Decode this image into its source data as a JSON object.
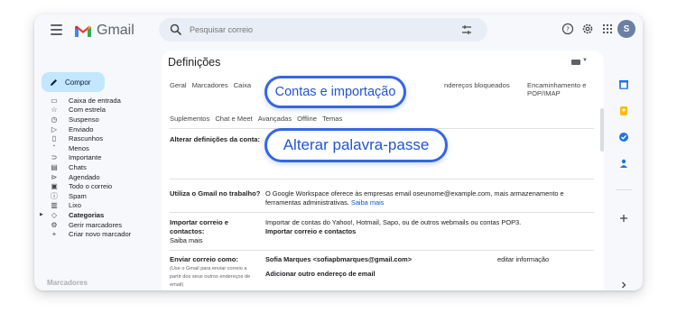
{
  "app": {
    "name": "Gmail"
  },
  "search": {
    "placeholder": "Pesquisar correio"
  },
  "account": {
    "avatar_letter": "S"
  },
  "compose": {
    "label": "Compor"
  },
  "sidebar": {
    "items": [
      {
        "label": "Caixa de entrada",
        "icon": "inbox-icon",
        "glyph": "▭"
      },
      {
        "label": "Com estrela",
        "icon": "star-icon",
        "glyph": "☆"
      },
      {
        "label": "Suspenso",
        "icon": "clock-icon",
        "glyph": "◷"
      },
      {
        "label": "Enviado",
        "icon": "send-icon",
        "glyph": "▷"
      },
      {
        "label": "Rascunhos",
        "icon": "draft-icon",
        "glyph": "▯"
      },
      {
        "label": "Menos",
        "icon": "chevron-up-icon",
        "glyph": "ˆ"
      },
      {
        "label": "Importante",
        "icon": "important-icon",
        "glyph": "⊃"
      },
      {
        "label": "Chats",
        "icon": "chat-icon",
        "glyph": "▤"
      },
      {
        "label": "Agendado",
        "icon": "scheduled-icon",
        "glyph": "⊳"
      },
      {
        "label": "Todo o correio",
        "icon": "all-mail-icon",
        "glyph": "▣"
      },
      {
        "label": "Spam",
        "icon": "spam-icon",
        "glyph": "ⓘ"
      },
      {
        "label": "Lixo",
        "icon": "trash-icon",
        "glyph": "▥"
      },
      {
        "label": "Categorias",
        "icon": "label-icon",
        "glyph": "◇",
        "bold": true
      },
      {
        "label": "Gerir marcadores",
        "icon": "gear-icon",
        "glyph": "⚙"
      },
      {
        "label": "Criar novo marcador",
        "icon": "plus-icon",
        "glyph": "+"
      }
    ]
  },
  "settings": {
    "title": "Definições",
    "tabs_row1": [
      "Geral",
      "Marcadores",
      "Caixa"
    ],
    "tabs_row1_right": [
      "ndereços bloqueados",
      "Encaminhamento e POP/IMAP"
    ],
    "tabs_row2": [
      "Suplementos",
      "Chat e Meet",
      "Avançadas",
      "Offline",
      "Temas"
    ],
    "sections": {
      "change_account": {
        "label": "Alterar definições da conta:"
      },
      "workspace": {
        "label": "Utiliza o Gmail no trabalho?",
        "text": "O Google Workspace oferece às empresas email oseunome@example.com, mais armazenamento e",
        "text2": "ferramentas administrativas.",
        "link": "Saiba mais"
      },
      "import": {
        "label": "Importar correio e",
        "label2": "contactos:",
        "label_link": "Saiba mais",
        "text": "Importar de contas do Yahoo!, Hotmail, Sapo, ou de outros webmails ou contas POP3.",
        "link": "Importar correio e contactos"
      },
      "send_as": {
        "label": "Enviar correio como:",
        "sub1": "(Use o Gmail para enviar correio a",
        "sub2": "partir dos seus outros endereços de",
        "sub3": "email)",
        "sender": "Sofia Marques <sofiapbmarques@gmail.com>",
        "edit_link": "editar informação",
        "add_link": "Adicionar outro endereço de email"
      }
    }
  },
  "callouts": {
    "tab_highlight": "Contas e importação",
    "password_highlight": "Alterar palavra-passe"
  },
  "colors": {
    "accent": "#3466e5",
    "compose_bg": "#c2e7ff",
    "link": "#0b57d0"
  }
}
